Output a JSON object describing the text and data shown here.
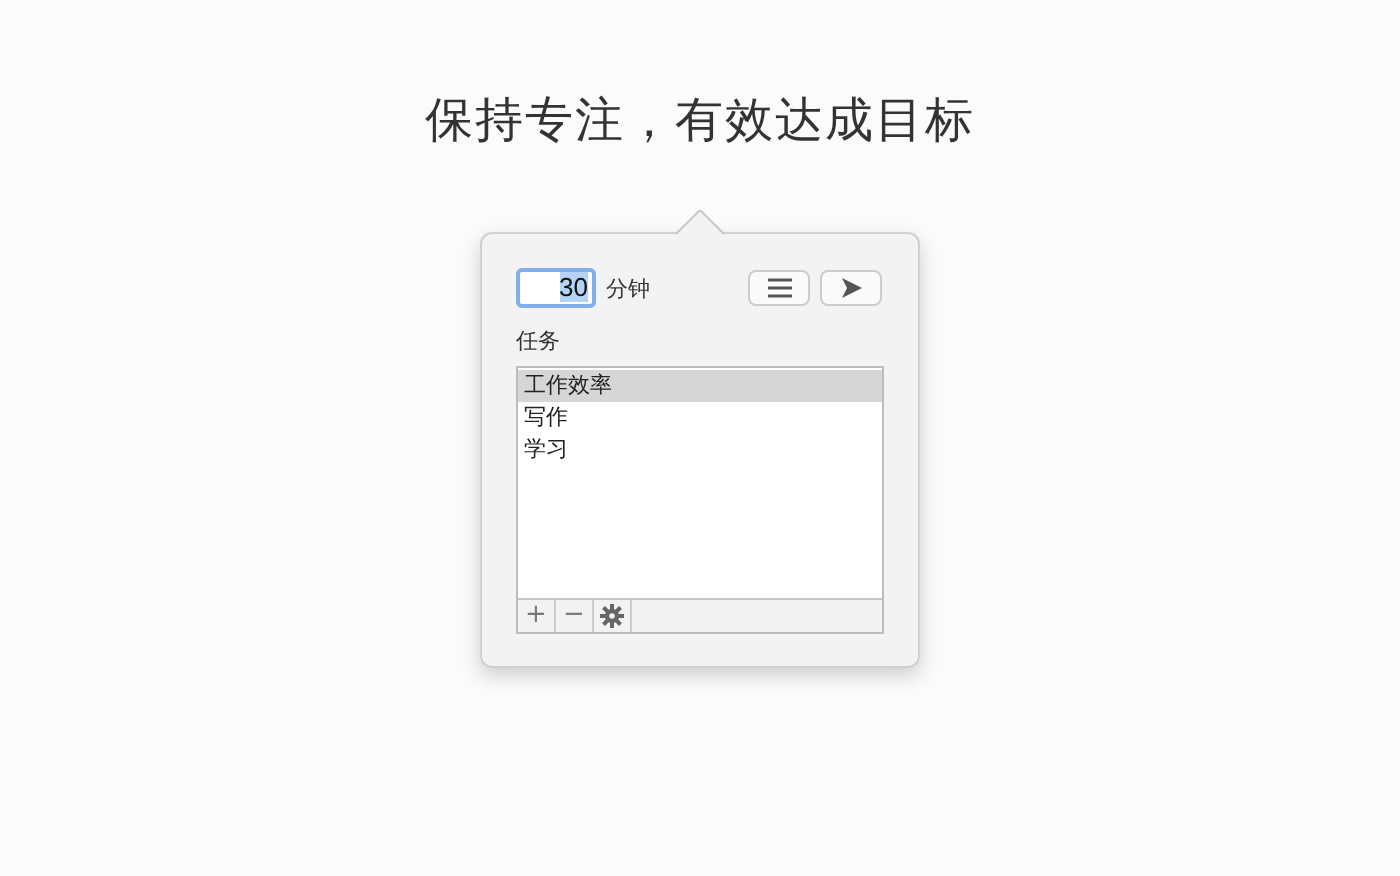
{
  "headline": "保持专注，有效达成目标",
  "popover": {
    "duration": {
      "value": "30",
      "unit": "分钟"
    },
    "tasks_label": "任务",
    "tasks": [
      {
        "label": "工作效率",
        "selected": true
      },
      {
        "label": "写作",
        "selected": false
      },
      {
        "label": "学习",
        "selected": false
      }
    ],
    "footer_buttons": [
      "+",
      "−"
    ]
  }
}
